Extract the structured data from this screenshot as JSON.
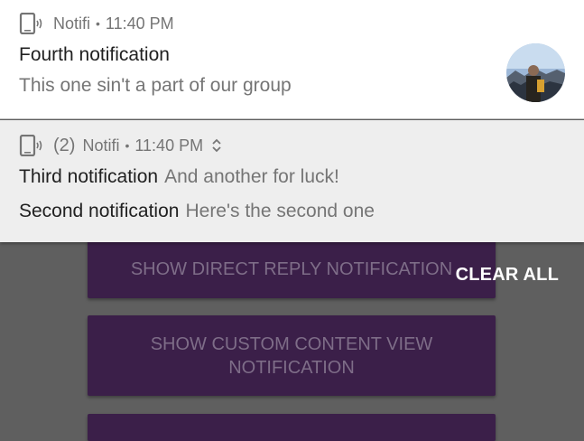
{
  "background": {
    "buttons": [
      {
        "label": "SHOW DIRECT REPLY NOTIFICATION"
      },
      {
        "label": "SHOW CUSTOM CONTENT VIEW NOTIFICATION"
      }
    ]
  },
  "clear_all_label": "CLEAR ALL",
  "notifications": [
    {
      "app_name": "Notifi",
      "time": "11:40 PM",
      "title": "Fourth notification",
      "text": "This one sin't a part of our group",
      "icon": "phone-vibrate-icon",
      "has_avatar": true
    },
    {
      "count": "(2)",
      "app_name": "Notifi",
      "time": "11:40 PM",
      "icon": "phone-vibrate-icon",
      "expand_icon": "expand-icon",
      "lines": [
        {
          "title": "Third notification",
          "text": "And another for luck!"
        },
        {
          "title": "Second notification",
          "text": "Here's the second one"
        }
      ]
    }
  ],
  "colors": {
    "scrim": "#5f5f5f",
    "button": "#3b1f49",
    "card_top": "#ffffff",
    "card_group": "#eeeeee"
  }
}
